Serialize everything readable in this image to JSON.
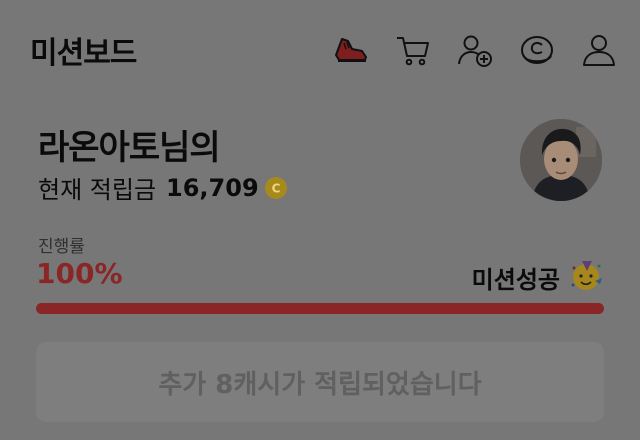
{
  "header": {
    "title": "미션보드",
    "icons": [
      "sneaker-icon",
      "cart-icon",
      "add-user-icon",
      "coin-icon",
      "profile-icon"
    ]
  },
  "profile": {
    "greeting": "라온아토님의",
    "points_label": "현재 적립금",
    "points_value": "16,709",
    "coin_symbol": "C"
  },
  "progress": {
    "caption": "진행률",
    "percent_text": "100%",
    "percent_value": 100,
    "status_text": "미션성공",
    "status_icon": "party-face-icon"
  },
  "cta": {
    "label": "추가 8캐시가 적립되었습니다"
  },
  "colors": {
    "accent": "#8a2626",
    "overlay_bg": "#777777",
    "coin": "#a78a1c"
  }
}
